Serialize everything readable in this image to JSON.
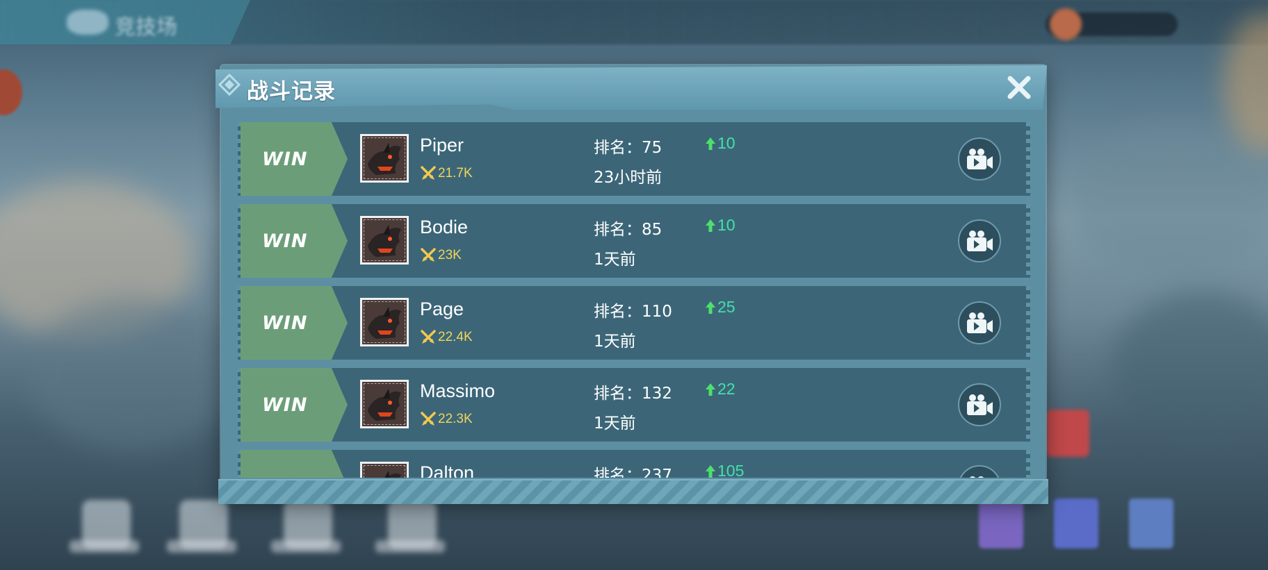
{
  "background": {
    "top_tab_label": "竞技场"
  },
  "dialog": {
    "title": "战斗记录",
    "close_label": "✕"
  },
  "records": [
    {
      "result": "WIN",
      "name": "Piper",
      "power": "21.7K",
      "rank_label": "排名：75",
      "rank_change": "10",
      "time": "23小时前"
    },
    {
      "result": "WIN",
      "name": "Bodie",
      "power": "23K",
      "rank_label": "排名：85",
      "rank_change": "10",
      "time": "1天前"
    },
    {
      "result": "WIN",
      "name": "Page",
      "power": "22.4K",
      "rank_label": "排名：110",
      "rank_change": "25",
      "time": "1天前"
    },
    {
      "result": "WIN",
      "name": "Massimo",
      "power": "22.3K",
      "rank_label": "排名：132",
      "rank_change": "22",
      "time": "1天前"
    },
    {
      "result": "WIN",
      "name": "Dalton",
      "power": "",
      "rank_label": "排名：237",
      "rank_change": "105",
      "time": ""
    }
  ],
  "colors": {
    "win_banner": "#6b9e78",
    "row_bg": "#3c6678",
    "power_text": "#f2d55a",
    "rank_up": "#45e0a8"
  },
  "icons": [
    "crossed-swords-icon",
    "arrow-up-icon",
    "video-replay-icon",
    "close-icon",
    "diamond-icon"
  ]
}
